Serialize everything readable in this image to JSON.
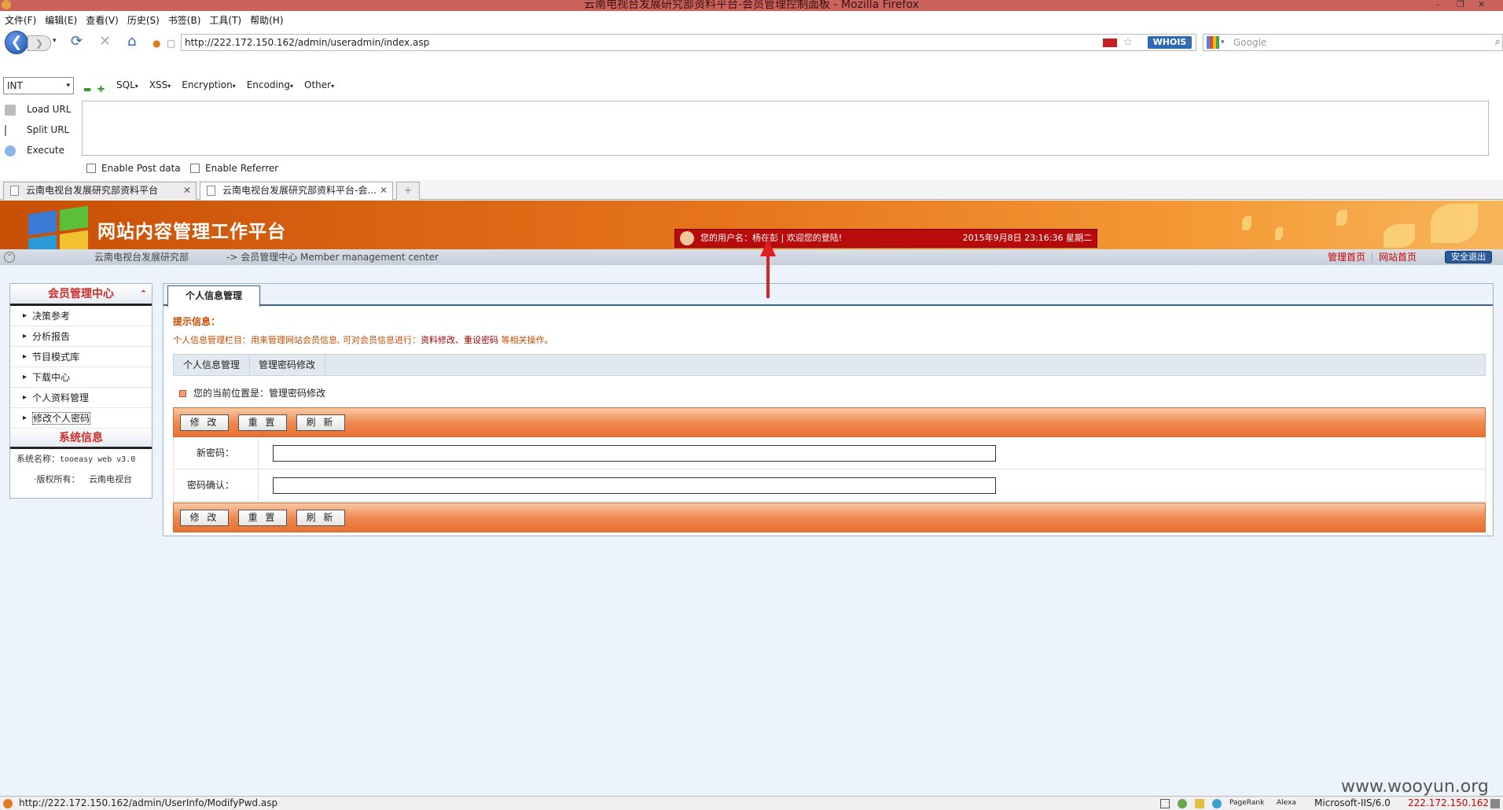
{
  "window": {
    "title": "云南电视台发展研究部资料平台-会员管理控制面板 - Mozilla Firefox"
  },
  "menu": [
    "文件(F)",
    "编辑(E)",
    "查看(V)",
    "历史(S)",
    "书签(B)",
    "工具(T)",
    "帮助(H)"
  ],
  "nav": {
    "url": "http://222.172.150.162/admin/useradmin/index.asp",
    "whois_label": "WHOIS",
    "search_placeholder": "Google"
  },
  "hackbar": {
    "select_value": "INT",
    "menus": [
      "SQL",
      "XSS",
      "Encryption",
      "Encoding",
      "Other"
    ],
    "actions": [
      "Load URL",
      "Split URL",
      "Execute"
    ],
    "post_label": "Enable Post data",
    "referrer_label": "Enable Referrer"
  },
  "tabs": [
    {
      "title": "云南电视台发展研究部资料平台"
    },
    {
      "title": "云南电视台发展研究部资料平台-会..."
    }
  ],
  "banner": {
    "site_title": "网站内容管理工作平台",
    "welcome": "您的用户名：杨在彭 | 欢迎您的登陆!",
    "datetime": "2015年9月8日 23:16:36 星期二"
  },
  "crumb": {
    "org": "云南电视台发展研究部",
    "path": "-> 会员管理中心  Member management center",
    "links": [
      "管理首页",
      "网站首页"
    ],
    "logout": "安全退出"
  },
  "sidebar": {
    "title": "会员管理中心",
    "items": [
      "决策参考",
      "分析报告",
      "节目模式库",
      "下载中心",
      "个人资料管理",
      "修改个人密码"
    ],
    "sys_title": "系统信息",
    "sys_name_label": "系统名称：",
    "sys_name_value": "tooeasy web v3.0",
    "copyright_label": "·版权所有：",
    "copyright_value": "云南电视台"
  },
  "main": {
    "tab": "个人信息管理",
    "tips_title": "提示信息：",
    "tips_text": "个人信息管理栏目：用来管理网站会员信息, 可对会员信息进行：",
    "tips_links": "资料修改、重设密码",
    "tips_tail": " 等相关操作。",
    "subnav": [
      "个人信息管理",
      "管理密码修改"
    ],
    "location": "您的当前位置是：管理密码修改",
    "buttons": [
      "修 改",
      "重 置",
      "刷 新"
    ],
    "fields": [
      {
        "label": "新密码：",
        "value": ""
      },
      {
        "label": "密码确认：",
        "value": ""
      }
    ]
  },
  "status": {
    "url": "http://222.172.150.162/admin/UserInfo/ModifyPwd.asp",
    "pagerank": "PageRank",
    "alexa": "Alexa",
    "server": "Microsoft-IIS/6.0",
    "ip": "222.172.150.162"
  },
  "watermark": "www.wooyun.org"
}
